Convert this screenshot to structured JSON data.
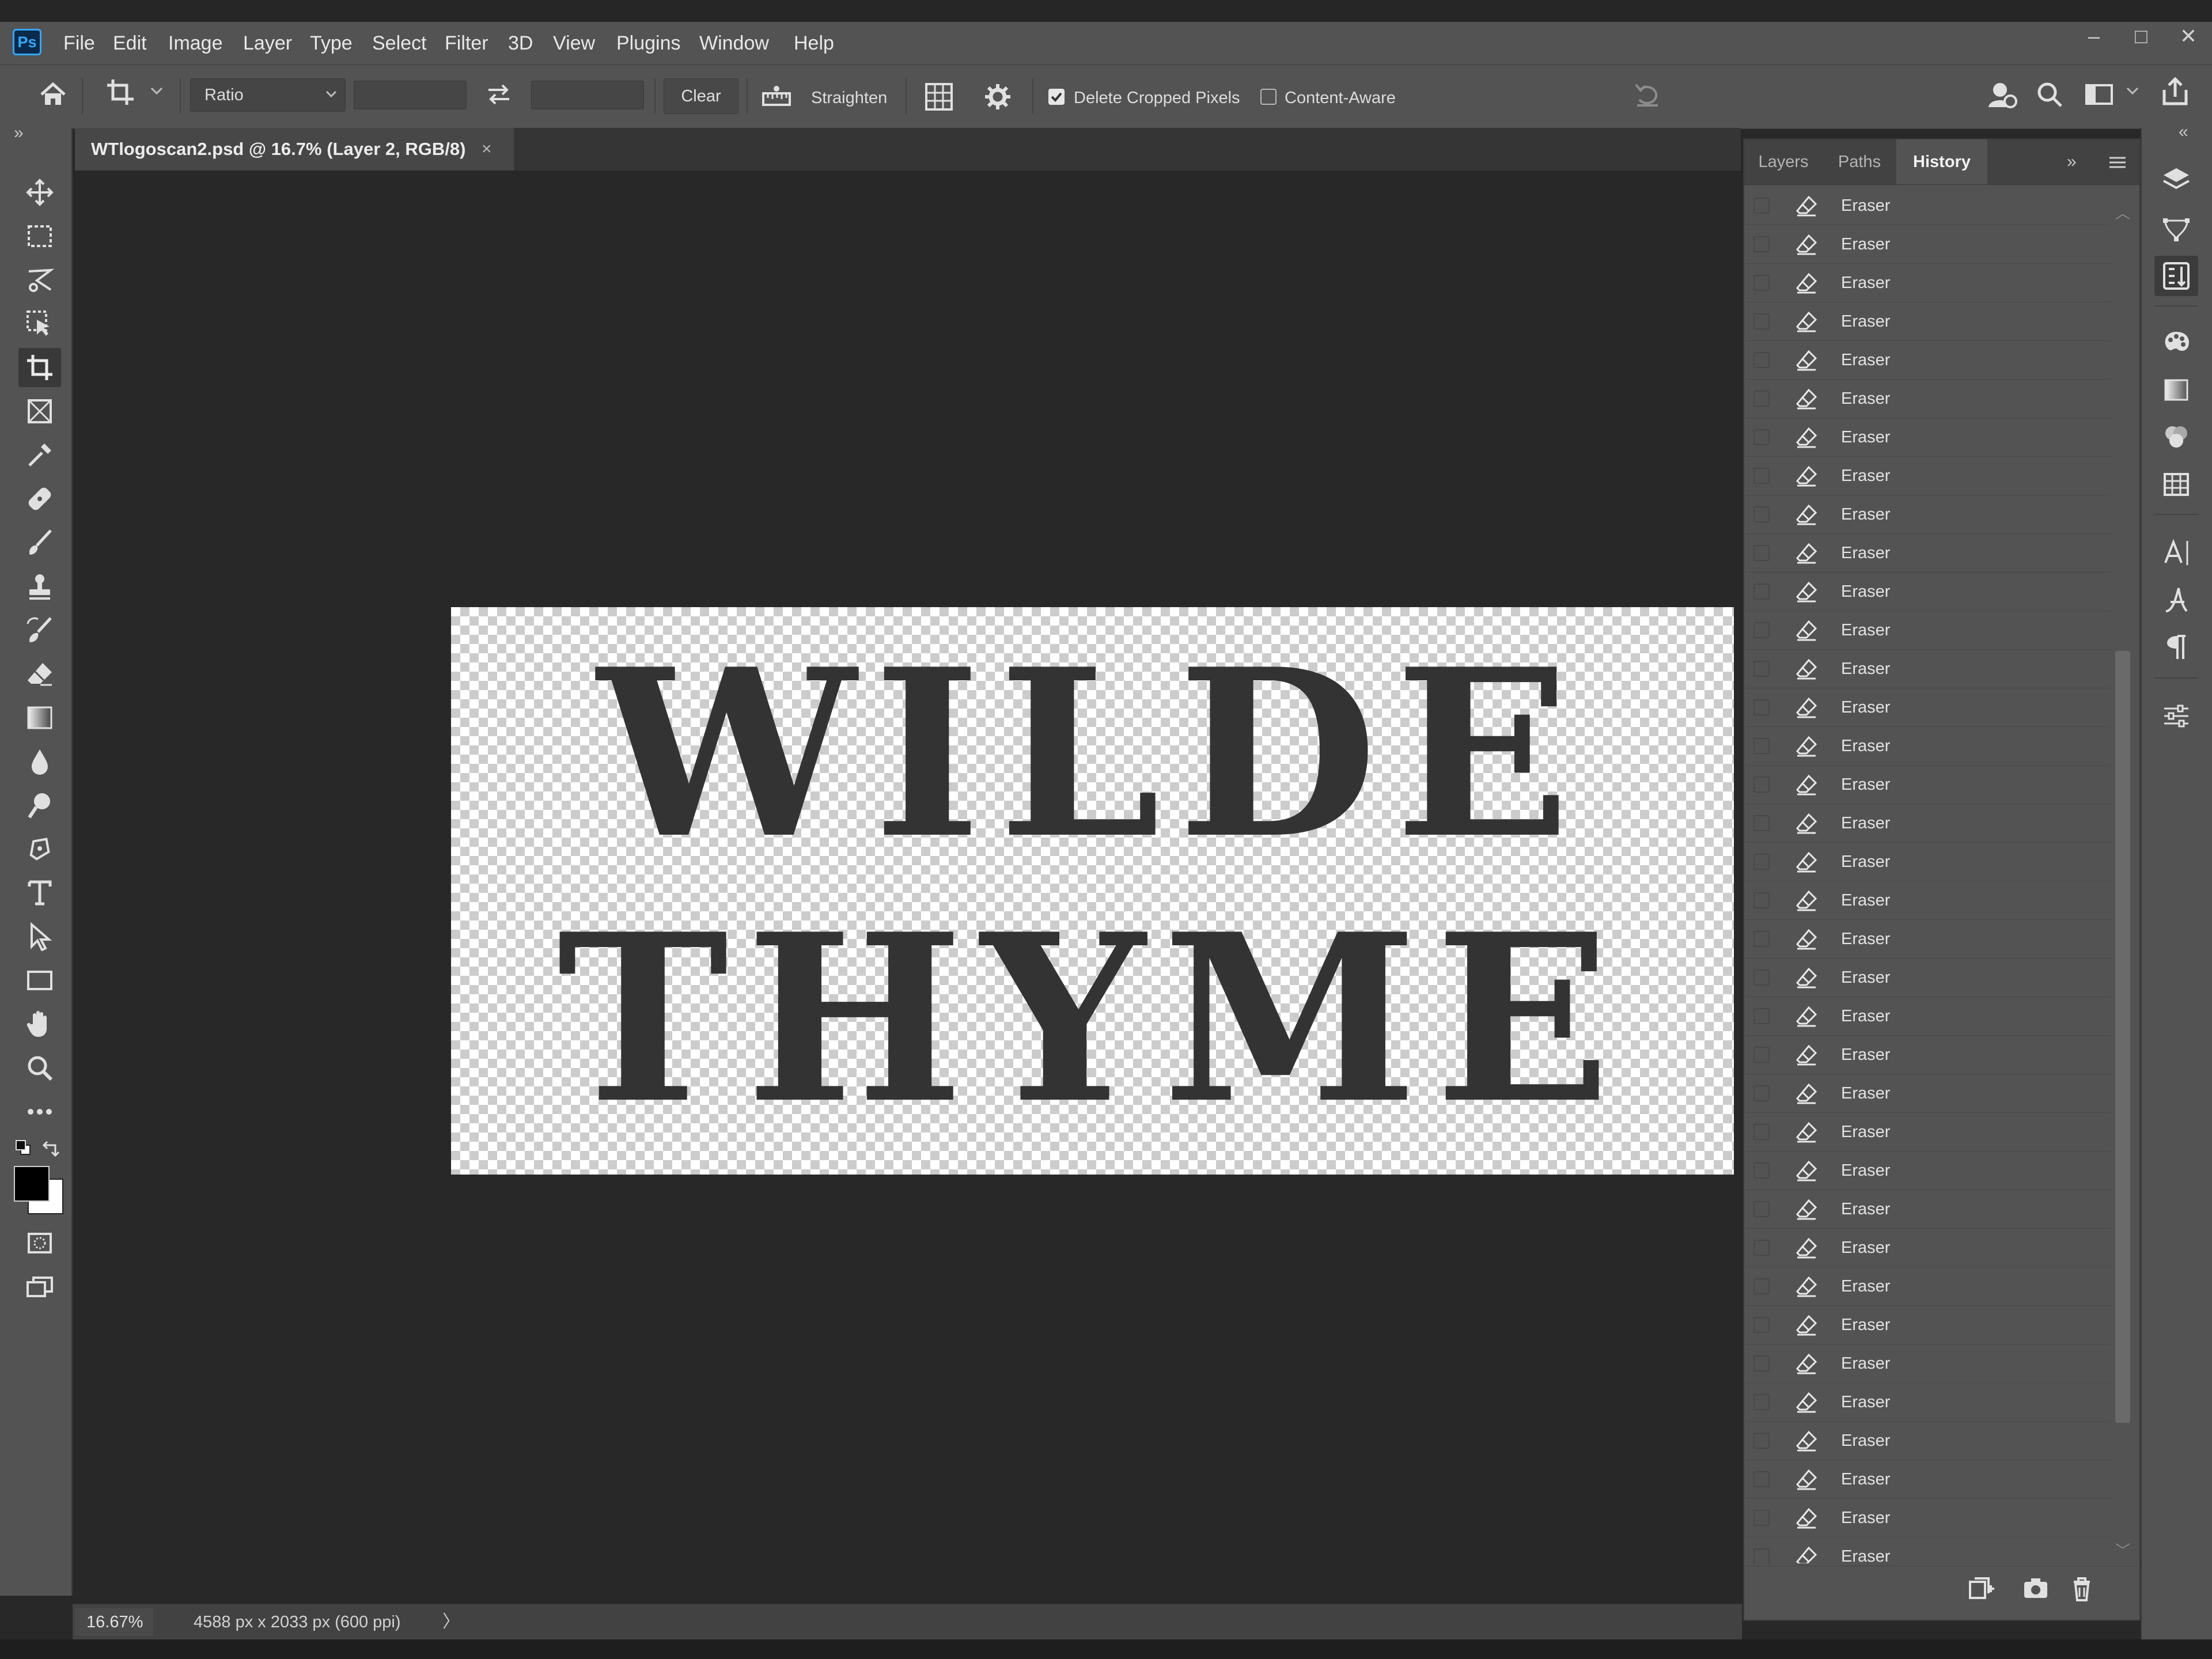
{
  "app": {
    "logo_text": "Ps",
    "menu": [
      "File",
      "Edit",
      "Image",
      "Layer",
      "Type",
      "Select",
      "Filter",
      "3D",
      "View",
      "Plugins",
      "Window",
      "Help"
    ],
    "window_controls": {
      "minimize": "–",
      "maximize": "□",
      "close": "✕"
    }
  },
  "options_bar": {
    "ratio": "Ratio",
    "width_value": "",
    "height_value": "",
    "clear_label": "Clear",
    "straighten_label": "Straighten",
    "delete_cropped_label": "Delete Cropped Pixels",
    "delete_cropped_checked": true,
    "content_aware_label": "Content-Aware",
    "content_aware_checked": false
  },
  "document": {
    "tab_title": "WTlogoscan2.psd @ 16.7% (Layer 2, RGB/8)",
    "close": "×",
    "canvas_text_line1": "WILDE",
    "canvas_text_line2": "THYME"
  },
  "statusbar": {
    "zoom": "16.67%",
    "doc_size": "4588 px x 2033 px (600 ppi)",
    "arrow": "〉"
  },
  "panel": {
    "tabs": [
      "Layers",
      "Paths",
      "History"
    ],
    "active_tab": "History",
    "expand": "»",
    "history_items": [
      "Eraser",
      "Eraser",
      "Eraser",
      "Eraser",
      "Eraser",
      "Eraser",
      "Eraser",
      "Eraser",
      "Eraser",
      "Eraser",
      "Eraser",
      "Eraser",
      "Eraser",
      "Eraser",
      "Eraser",
      "Eraser",
      "Eraser",
      "Eraser",
      "Eraser",
      "Eraser",
      "Eraser",
      "Eraser",
      "Eraser",
      "Eraser",
      "Eraser",
      "Eraser",
      "Eraser",
      "Eraser",
      "Eraser",
      "Eraser",
      "Eraser",
      "Eraser",
      "Eraser",
      "Eraser",
      "Eraser",
      "Eraser"
    ],
    "history_icon": "eraser-icon"
  },
  "left_tools": [
    "move-tool-icon",
    "marquee-tool-icon",
    "lasso-tool-icon",
    "object-select-tool-icon",
    "crop-tool-icon",
    "frame-tool-icon",
    "eyedropper-tool-icon",
    "healing-brush-tool-icon",
    "brush-tool-icon",
    "clone-stamp-tool-icon",
    "history-brush-tool-icon",
    "eraser-tool-icon",
    "gradient-tool-icon",
    "blur-tool-icon",
    "dodge-tool-icon",
    "pen-tool-icon",
    "type-tool-icon",
    "path-select-tool-icon",
    "rectangle-tool-icon",
    "hand-tool-icon",
    "zoom-tool-icon",
    "more-tools-icon"
  ],
  "right_icons": [
    "layers-panel-icon",
    "paths-panel-icon",
    "history-panel-icon",
    "color-panel-icon",
    "gradients-panel-icon",
    "swatches-panel-icon",
    "patterns-panel-icon",
    "character-panel-icon",
    "glyphs-panel-icon",
    "paragraph-panel-icon",
    "properties-panel-icon"
  ],
  "colors": {
    "ui_bg": "#535353",
    "canvas_bg": "#282828",
    "accent": "#31a8ff",
    "foreground_color": "#000000",
    "background_color": "#ffffff"
  }
}
